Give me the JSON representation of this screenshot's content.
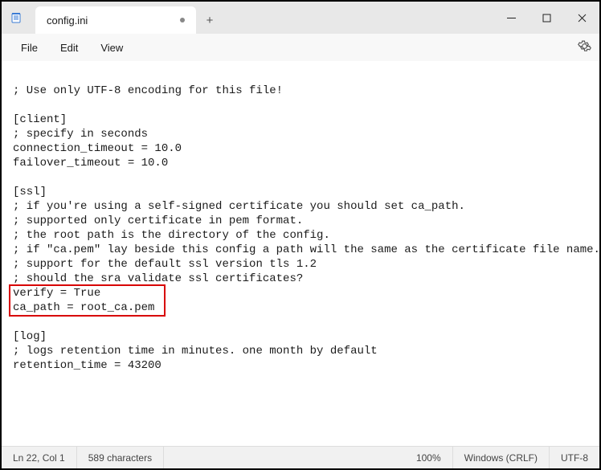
{
  "tab": {
    "title": "config.ini",
    "dirty": true,
    "new_tab_icon": "+"
  },
  "menu": {
    "file": "File",
    "edit": "Edit",
    "view": "View"
  },
  "content": {
    "l0": "",
    "l1": "; Use only UTF-8 encoding for this file!",
    "l2": "",
    "l3": "[client]",
    "l4": "; specify in seconds",
    "l5": "connection_timeout = 10.0",
    "l6": "failover_timeout = 10.0",
    "l7": "",
    "l8": "[ssl]",
    "l9": "; if you're using a self-signed certificate you should set ca_path.",
    "l10": "; supported only certificate in pem format.",
    "l11": "; the root path is the directory of the config.",
    "l12": "; if \"ca.pem\" lay beside this config a path will the same as the certificate file name.",
    "l13": "; support for the default ssl version tls 1.2",
    "l14": "; should the sra validate ssl certificates?",
    "l15": "verify = True",
    "l16": "ca_path = root_ca.pem",
    "l17": "",
    "l18": "[log]",
    "l19": "; logs retention time in minutes. one month by default",
    "l20": "retention_time = 43200",
    "l21": ""
  },
  "status": {
    "position": "Ln 22, Col 1",
    "chars": "589 characters",
    "zoom": "100%",
    "line_ending": "Windows (CRLF)",
    "encoding": "UTF-8"
  }
}
